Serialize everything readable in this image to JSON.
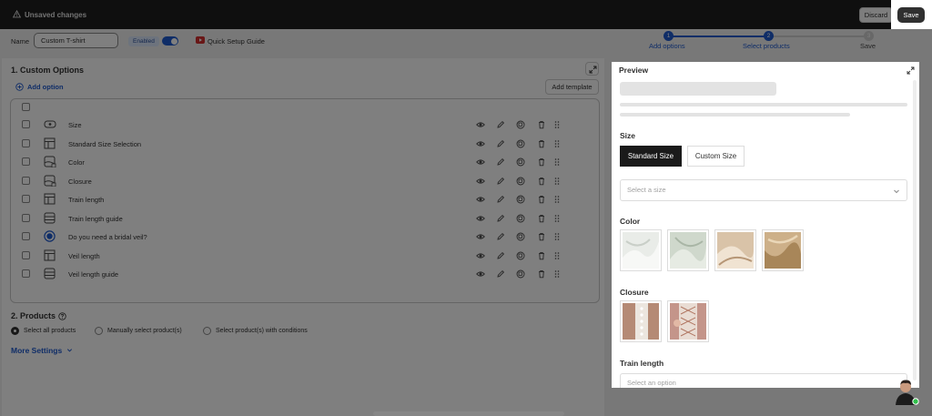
{
  "topbar": {
    "unsaved_text": "Unsaved changes",
    "discard_label": "Discard",
    "save_label": "Save"
  },
  "namebar": {
    "name_label": "Name",
    "name_value": "Custom T-shirt",
    "enabled_badge": "Enabled",
    "quick_setup_label": "Quick Setup Guide"
  },
  "steps": [
    {
      "number": "1",
      "label": "Add options",
      "state": "done"
    },
    {
      "number": "2",
      "label": "Select products",
      "state": "done"
    },
    {
      "number": "3",
      "label": "Save",
      "state": "todo"
    }
  ],
  "custom_options": {
    "title": "1. Custom Options",
    "add_option_label": "Add option",
    "add_template_label": "Add template",
    "rows": [
      {
        "label": "Size",
        "icon": "button-type-icon"
      },
      {
        "label": "Standard Size Selection",
        "icon": "table-type-icon"
      },
      {
        "label": "Color",
        "icon": "image-swatch-icon"
      },
      {
        "label": "Closure",
        "icon": "image-swatch-icon"
      },
      {
        "label": "Train length",
        "icon": "table-type-icon"
      },
      {
        "label": "Train length guide",
        "icon": "dropdown-type-icon"
      },
      {
        "label": "Do you need a bridal veil?",
        "icon": "radio-type-icon"
      },
      {
        "label": "Veil length",
        "icon": "table-type-icon"
      },
      {
        "label": "Veil length guide",
        "icon": "dropdown-type-icon"
      }
    ]
  },
  "products": {
    "title": "2. Products",
    "options": [
      {
        "label": "Select all products",
        "selected": true
      },
      {
        "label": "Manually select product(s)",
        "selected": false
      },
      {
        "label": "Select product(s) with conditions",
        "selected": false
      }
    ],
    "more_settings_label": "More Settings"
  },
  "preview": {
    "title": "Preview",
    "size_label": "Size",
    "size_buttons": [
      "Standard Size",
      "Custom Size"
    ],
    "size_placeholder": "Select a size",
    "color_label": "Color",
    "closure_label": "Closure",
    "train_label": "Train length",
    "train_placeholder": "Select an option"
  },
  "colors": {
    "accent": "#1f5acf",
    "dark_button": "#303030",
    "swatch_1": "#e9ece8",
    "swatch_2": "#cfd8cc",
    "swatch_3": "#d9c3a8",
    "swatch_4": "#cdb089"
  }
}
